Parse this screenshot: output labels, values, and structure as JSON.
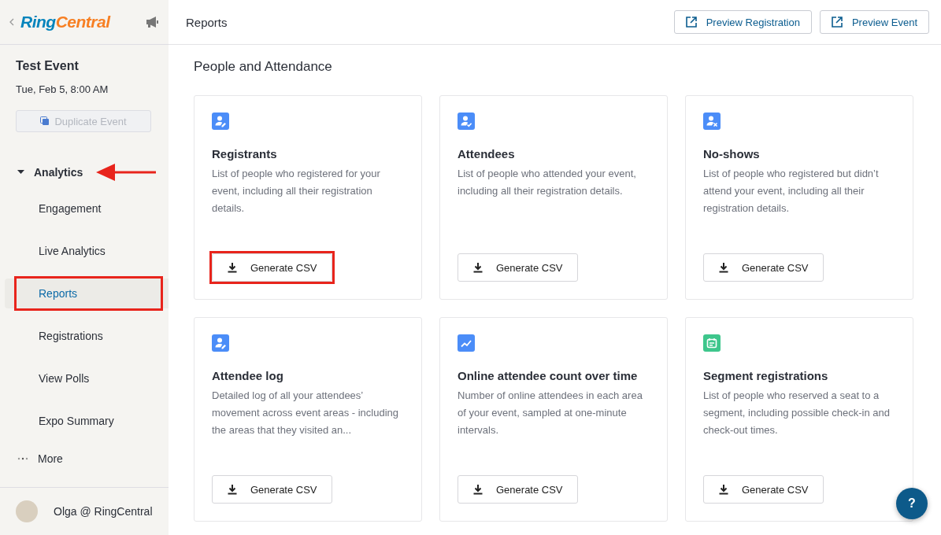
{
  "sidebar": {
    "logo": [
      "Ring",
      "Central"
    ],
    "event_title": "Test Event",
    "event_date": "Tue, Feb 5, 8:00 AM",
    "duplicate_button": {
      "label": "Duplicate Event",
      "disabled": true
    },
    "section": {
      "label": "Analytics",
      "expanded": true,
      "annotated": true
    },
    "items": [
      {
        "label": "Engagement",
        "selected": false,
        "annotated": false
      },
      {
        "label": "Live Analytics",
        "selected": false,
        "annotated": false
      },
      {
        "label": "Reports",
        "selected": true,
        "annotated": true
      },
      {
        "label": "Registrations",
        "selected": false,
        "annotated": false
      },
      {
        "label": "View Polls",
        "selected": false,
        "annotated": false
      },
      {
        "label": "Expo Summary",
        "selected": false,
        "annotated": false
      }
    ],
    "more": "More",
    "user": "Olga @ RingCentral"
  },
  "header": {
    "title": "Reports",
    "buttons": [
      "Preview Registration",
      "Preview Event"
    ]
  },
  "section_title": "People and Attendance",
  "cards": [
    {
      "kind": "person-edit",
      "title": "Registrants",
      "description": "List of people who registered for your event, including all their registration details.",
      "button": "Generate CSV",
      "annotated": true
    },
    {
      "kind": "person-check",
      "title": "Attendees",
      "description": "List of people who attended your event, including all their registration details.",
      "button": "Generate CSV",
      "annotated": false
    },
    {
      "kind": "person-x",
      "title": "No-shows",
      "description": "List of people who registered but didn’t attend your event, including all their registration details.",
      "button": "Generate CSV",
      "annotated": false
    },
    {
      "kind": "person-edit",
      "title": "Attendee log",
      "description": "Detailed log of all your attendees’ movement across event areas - including the areas that they visited an...",
      "button": "Generate CSV",
      "annotated": false
    },
    {
      "kind": "trend",
      "title": "Online attendee count over time",
      "description": "Number of online attendees in each area of your event, sampled at one-minute intervals.",
      "button": "Generate CSV",
      "annotated": false
    },
    {
      "kind": "calendar",
      "title": "Segment registrations",
      "description": "List of people who reserved a seat to a segment, including possible check-in and check-out times.",
      "button": "Generate CSV",
      "annotated": false
    }
  ],
  "help_button": "?"
}
